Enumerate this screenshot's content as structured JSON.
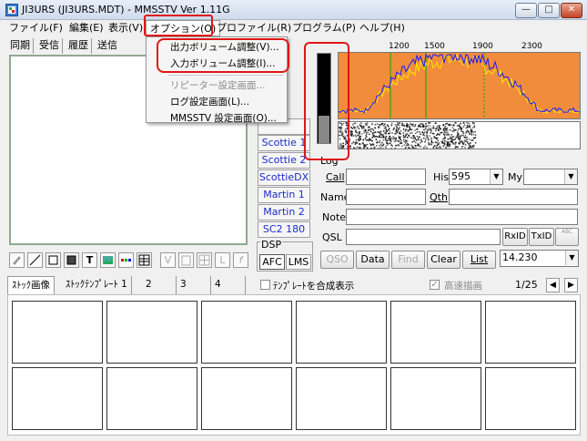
{
  "window": {
    "title": "JI3URS (JI3URS.MDT) - MMSSTV Ver 1.11G",
    "minimize": "—",
    "maximize": "□",
    "close": "✕"
  },
  "menu": {
    "items": [
      "ファイル(F)",
      "編集(E)",
      "表示(V)",
      "オプション(O)",
      "プロファイル(R)",
      "プログラム(P)",
      "ヘルプ(H)"
    ]
  },
  "dropdown": {
    "items": [
      "出力ボリューム調整(V)...",
      "入力ボリューム調整(I)...",
      "リピーター設定画面...",
      "ログ設定画面(L)...",
      "MMSSTV 設定画面(O)..."
    ],
    "disabled_index": 2
  },
  "left_tabs": [
    "同期",
    "受信",
    "履歴",
    "送信"
  ],
  "tools": {
    "text_tool": "T",
    "letter_l": "L",
    "letter_f": "f",
    "letter_v": "V"
  },
  "spectrum": {
    "freq_labels": [
      "1200",
      "1500",
      "1900",
      "2300"
    ],
    "colors": {
      "background": "#f08c3c",
      "trace_blue": "#1a1aff",
      "trace_yellow": "#ffe600",
      "marker_green": "#00b000"
    }
  },
  "modes": [
    "Scottie 1",
    "Scottie 2",
    "ScottieDX",
    "Martin 1",
    "Martin 2",
    "SC2 180"
  ],
  "dsp": {
    "label": "DSP",
    "afc": "AFC",
    "lms": "LMS"
  },
  "log": {
    "title": "Log",
    "call_label": "Call",
    "his_label": "His",
    "his_value": "595",
    "my_label": "My",
    "name_label": "Name",
    "qth_label": "Qth",
    "note_label": "Note",
    "qsl_label": "QSL",
    "rxid": "RxID",
    "txid": "TxID",
    "abc": "ABC",
    "buttons": [
      "QSO",
      "Data",
      "Find",
      "Clear",
      "List"
    ],
    "freq_value": "14.230"
  },
  "stock": {
    "tabs": [
      "ｽﾄｯｸ画像",
      "ｽﾄｯｸﾃﾝﾌﾟﾚｰﾄ 1",
      "2",
      "3",
      "4"
    ],
    "template_check_label": "ﾃﾝﾌﾟﾚｰﾄを合成表示",
    "fast_draw_label": "高速描画",
    "page": "1/25"
  }
}
